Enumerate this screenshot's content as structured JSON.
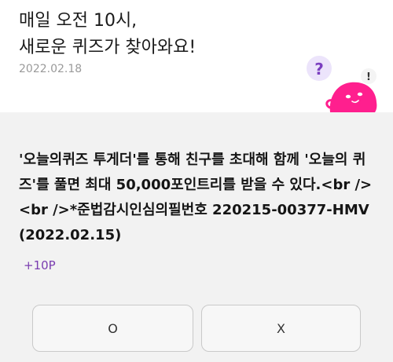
{
  "header": {
    "title": "매일 오전 10시,\n새로운 퀴즈가 찾아와요!",
    "date": "2022.02.18"
  },
  "mascot": {
    "icon": "pink-blob-mascot-icon",
    "question_mark": "?",
    "exclamation_mark": "!",
    "colors": {
      "body": "#ff1f8e",
      "question_bubble": "#ece4fb",
      "question_mark": "#7b3fc0",
      "exclamation_bubble": "#f4f4f4"
    }
  },
  "quiz": {
    "question": "'오늘의퀴즈 투게더'를 통해 친구를 초대해 함께 '오늘의 퀴즈'를 풀면 최대 50,000포인트리를 받을 수 있다.<br /><br />*준법감시인심의필번호 220215-00377-HMV(2022.02.15)",
    "points": "+10P"
  },
  "answers": {
    "o_label": "O",
    "x_label": "X"
  },
  "colors": {
    "page_background": "#f2f2f2",
    "header_background": "#ffffff",
    "points_text": "#7a3db0",
    "date_text": "#9a9a9a"
  }
}
